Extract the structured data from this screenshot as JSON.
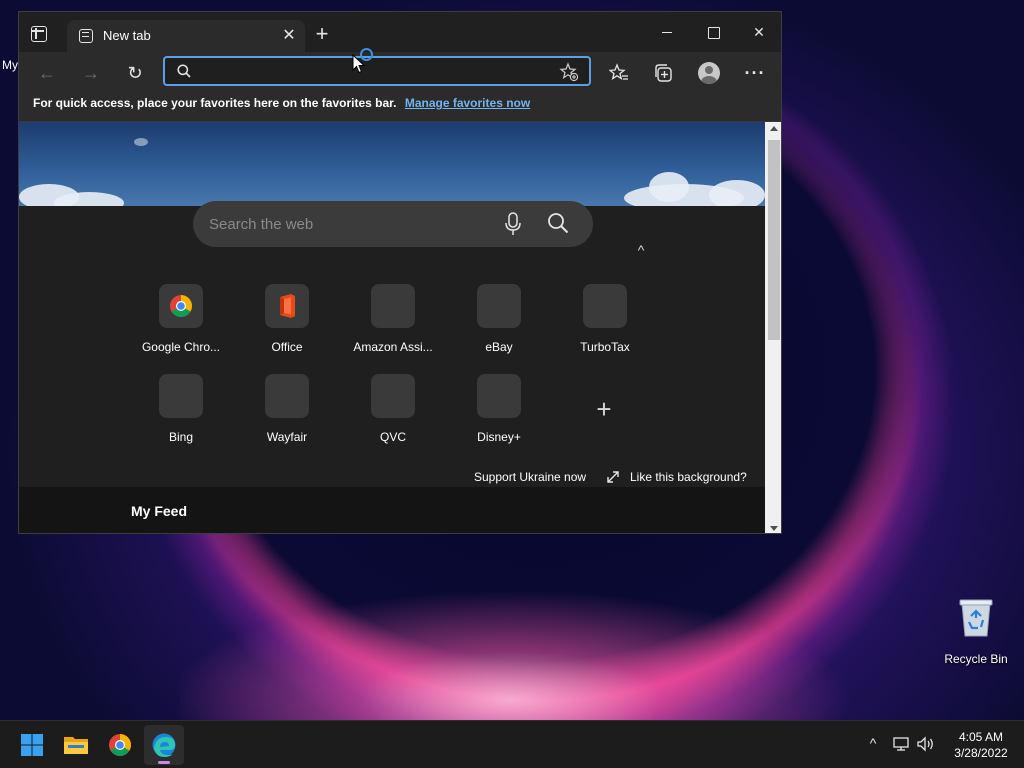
{
  "desktop": {
    "partial_label": "My",
    "recycle_bin_label": "Recycle Bin"
  },
  "browser": {
    "tab": {
      "title": "New tab",
      "close_glyph": "✕"
    },
    "new_tab_glyph": "+",
    "window_controls": {
      "close_glyph": "✕"
    },
    "toolbar": {
      "back_glyph": "←",
      "forward_glyph": "→",
      "refresh_glyph": "↻",
      "address_value": "",
      "address_placeholder": "",
      "menu_glyph": "···"
    },
    "favorites_bar": {
      "message": "For quick access, place your favorites here on the favorites bar.",
      "link": "Manage favorites now"
    },
    "new_tab_page": {
      "search_placeholder": "Search the web",
      "collapse_glyph": "^",
      "quick_links": [
        {
          "label": "Google Chro...",
          "icon": "chrome-icon"
        },
        {
          "label": "Office",
          "icon": "office-icon"
        },
        {
          "label": "Amazon Assi...",
          "icon": "blank-tile"
        },
        {
          "label": "eBay",
          "icon": "blank-tile"
        },
        {
          "label": "TurboTax",
          "icon": "blank-tile"
        },
        {
          "label": "Bing",
          "icon": "blank-tile"
        },
        {
          "label": "Wayfair",
          "icon": "blank-tile"
        },
        {
          "label": "QVC",
          "icon": "blank-tile"
        },
        {
          "label": "Disney+",
          "icon": "blank-tile"
        }
      ],
      "add_site_glyph": "+",
      "support_link": "Support Ukraine now",
      "background_link": "Like this background?",
      "feed_title": "My Feed"
    }
  },
  "taskbar": {
    "apps": [
      "start-icon",
      "file-explorer-icon",
      "chrome-icon",
      "edge-icon"
    ],
    "tray_chevron_glyph": "^",
    "clock": {
      "time": "4:05 AM",
      "date": "3/28/2022"
    }
  },
  "colors": {
    "accent": "#5aa1e3",
    "link": "#74b4f2",
    "window_bg": "#2b2b2b",
    "taskbar_bg": "#1c1c1c"
  }
}
